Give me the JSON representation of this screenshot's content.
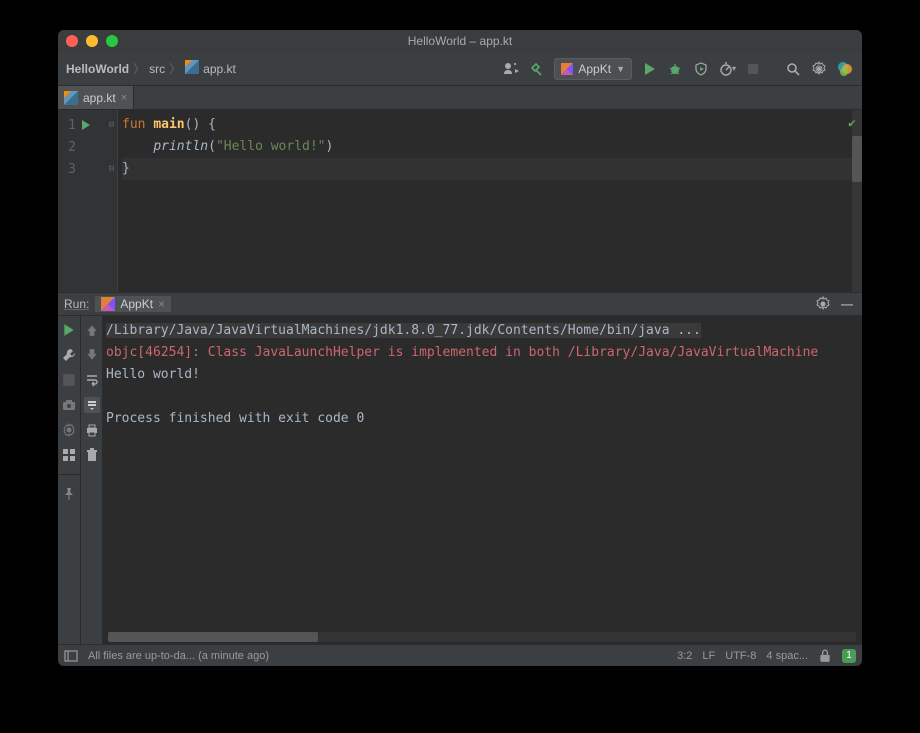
{
  "window": {
    "title": "HelloWorld – app.kt"
  },
  "breadcrumb": {
    "project": "HelloWorld",
    "dir": "src",
    "file": "app.kt"
  },
  "run_config": {
    "name": "AppKt"
  },
  "editor_tab": {
    "label": "app.kt"
  },
  "code": {
    "line1_kw": "fun ",
    "line1_fn": "main",
    "line1_rest": "() {",
    "line2_indent": "    ",
    "line2_fn": "println",
    "line2_open": "(",
    "line2_str": "\"Hello world!\"",
    "line2_close": ")",
    "line3": "}",
    "lineno1": "1",
    "lineno2": "2",
    "lineno3": "3"
  },
  "run_panel": {
    "label": "Run:",
    "tab": "AppKt"
  },
  "console": {
    "path": "/Library/Java/JavaVirtualMachines/jdk1.8.0_77.jdk/Contents/Home/bin/java ...",
    "err": "objc[46254]: Class JavaLaunchHelper is implemented in both /Library/Java/JavaVirtualMachine",
    "output": "Hello world!",
    "exit": "Process finished with exit code 0"
  },
  "status": {
    "sync": "All files are up-to-da...",
    "sync_time": "(a minute ago)",
    "caret": "3:2",
    "line_sep": "LF",
    "encoding": "UTF-8",
    "indent": "4 spac...",
    "badge": "1"
  }
}
